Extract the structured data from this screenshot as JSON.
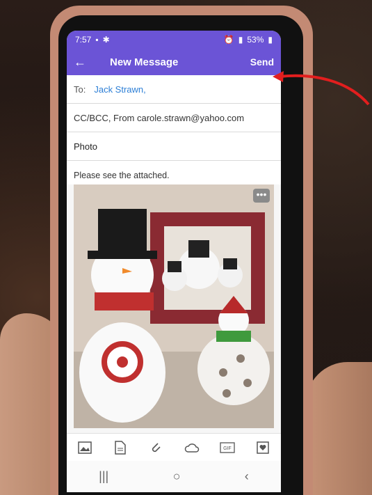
{
  "status_bar": {
    "time": "7:57",
    "battery": "53%"
  },
  "header": {
    "title": "New Message",
    "send_label": "Send"
  },
  "compose": {
    "to_label": "To:",
    "to_recipient": "Jack Strawn,",
    "cc_line": "CC/BCC, From carole.strawn@yahoo.com",
    "subject": "Photo",
    "body": "Please see the attached."
  },
  "attachment": {
    "more_label": "•••"
  },
  "toolbar": {
    "items": [
      "image-icon",
      "document-icon",
      "paperclip-icon",
      "cloud-icon",
      "gif-icon",
      "sticker-icon"
    ],
    "gif_label": "GIF"
  },
  "navbar": {
    "recents": "|||",
    "home": "○",
    "back": "‹"
  },
  "colors": {
    "header": "#6b54d6",
    "link": "#2d7fd6",
    "arrow": "#e21e1e"
  }
}
